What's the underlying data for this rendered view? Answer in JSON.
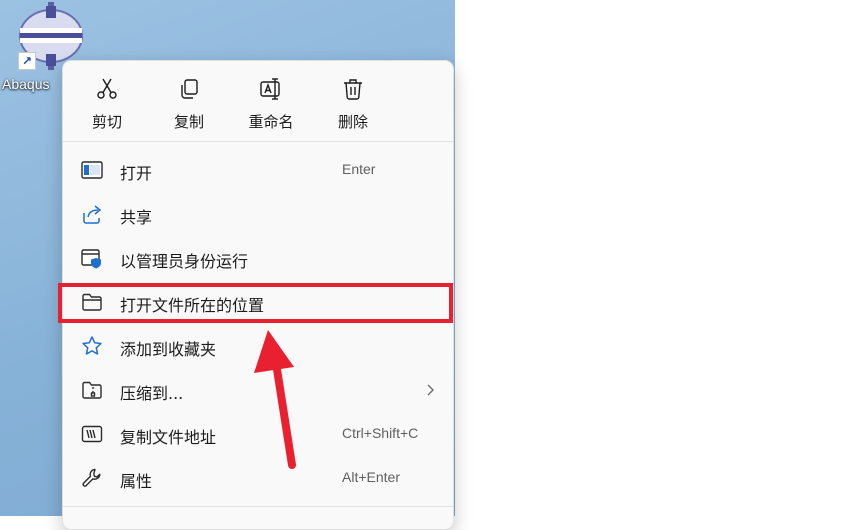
{
  "desktop": {
    "icon_label": "Abaqus",
    "shortcut_glyph": "↗"
  },
  "quick_actions": [
    {
      "label": "剪切",
      "icon": "scissors-icon"
    },
    {
      "label": "复制",
      "icon": "copy-icon"
    },
    {
      "label": "重命名",
      "icon": "rename-icon"
    },
    {
      "label": "删除",
      "icon": "trash-icon"
    }
  ],
  "menu_items": [
    {
      "label": "打开",
      "shortcut": "Enter",
      "icon": "open-window-icon"
    },
    {
      "label": "共享",
      "shortcut": "",
      "icon": "share-icon"
    },
    {
      "label": "以管理员身份运行",
      "shortcut": "",
      "icon": "admin-shield-icon"
    },
    {
      "label": "打开文件所在的位置",
      "shortcut": "",
      "icon": "folder-icon",
      "highlighted": true
    },
    {
      "label": "添加到收藏夹",
      "shortcut": "",
      "icon": "star-icon"
    },
    {
      "label": "压缩到...",
      "shortcut": "",
      "icon": "zip-folder-icon",
      "has_submenu": true
    },
    {
      "label": "复制文件地址",
      "shortcut": "Ctrl+Shift+C",
      "icon": "copy-path-icon"
    },
    {
      "label": "属性",
      "shortcut": "Alt+Enter",
      "icon": "wrench-icon"
    }
  ],
  "colors": {
    "accent": "#0067c0",
    "annotation_red": "#e8202f",
    "menu_bg": "#f9f9f9",
    "desktop_bg": "#8db6db"
  }
}
